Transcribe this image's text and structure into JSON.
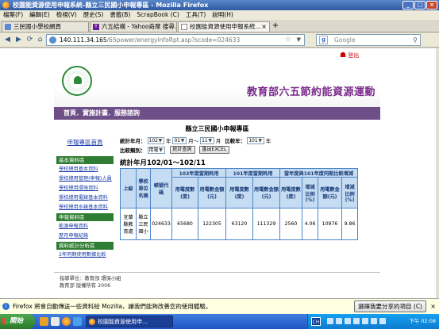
{
  "window": {
    "title": "校園能資源使用申報系統-縣立三民國小申報專區 - Mozilla Firefox",
    "controls": [
      "_",
      "□",
      "×"
    ]
  },
  "menu": [
    "檔案(F)",
    "編輯(E)",
    "檢視(V)",
    "歷史(S)",
    "書籤(B)",
    "ScrapBook (C)",
    "工具(T)",
    "說明(H)"
  ],
  "tabs": [
    {
      "label": "三民國小學校網頁"
    },
    {
      "label": "六五結構 - Yahoo奇摩 搜尋..."
    },
    {
      "label": "校園能資源使用申報系統..."
    }
  ],
  "nav": {
    "url_host": "140.111.34.165",
    "url_path": "/65power/energyInfoRpt.asp?scode=024633",
    "search_placeholder": "Google"
  },
  "page": {
    "logout": "登出",
    "site_title": "教育部六五節約能資源運動",
    "top_nav": "首頁．實施計畫．服務諮詢",
    "page_title": "縣立三民國小申報專區"
  },
  "sidebar": {
    "home": "申報專區首頁",
    "sections": [
      {
        "title": "基本資料區",
        "links": [
          "學校總用基本資料",
          "學校總用管理(申報)人員",
          "學校總用環境資料",
          "學校總用電錶基本資料",
          "學校總用水錶基本資料"
        ]
      },
      {
        "title": "申報資料區",
        "links": [
          "能源申報資料",
          "歷月申報紀錄"
        ]
      },
      {
        "title": "資料統計分析區",
        "links": [
          "2年同期使用數據比較"
        ]
      }
    ]
  },
  "filter": {
    "label_period": "統計年月：",
    "start_year": "102",
    "label_year": "年",
    "start_month": "01",
    "label_month_to": "月～",
    "end_month": "11",
    "label_month": "月",
    "label_compare_year": "比較年：",
    "compare_year": "101",
    "label_year2": "年",
    "label_type": "比較類別：",
    "type": "用電",
    "query_button": "統計查詢",
    "export_button": "匯出EXCEL"
  },
  "report": {
    "period_heading": "統計年月102/01～102/11",
    "headers": {
      "unit": "上級",
      "school": "學校單位名稱",
      "account": "帳號代碼",
      "group_102": "102年度當期耗用",
      "group_101": "101年度當期耗用",
      "group_diff": "當年度與101年度同期比較增減",
      "kwh_102": "用電度數(度)",
      "amount_102": "用電數金額(元)",
      "kwh_101": "用電度數(度)",
      "amount_101": "用電數金額(元)",
      "diff_kwh": "用電度數(度)",
      "diff_kwh_pct": "增減比例(%)",
      "diff_amount": "用電數金額(元)",
      "diff_amount_pct": "增減比例(%)"
    },
    "rows": [
      {
        "unit": "宜蘭縣教育處",
        "school": "縣立三民國小",
        "account": "024633",
        "kwh_102": "65680",
        "amount_102": "122305",
        "kwh_101": "63120",
        "amount_101": "111329",
        "diff_kwh": "2560",
        "diff_kwh_pct": "4.06",
        "diff_amount": "10976",
        "diff_amount_pct": "9.86"
      }
    ]
  },
  "footer": {
    "line1": "指導單位：教育部 環保小組",
    "line2": "教育部 版權所有 2006"
  },
  "notification": {
    "text": "Firefox 將會自動傳送一些資料給 Mozilla，讓我們能夠改善您的使用體驗。",
    "button": "選擇我要分享的項目 (C)"
  },
  "taskbar": {
    "start": "開始",
    "items": [
      "校園能資源使用申..."
    ],
    "lang": "CH",
    "clock": "下午 02:08"
  }
}
